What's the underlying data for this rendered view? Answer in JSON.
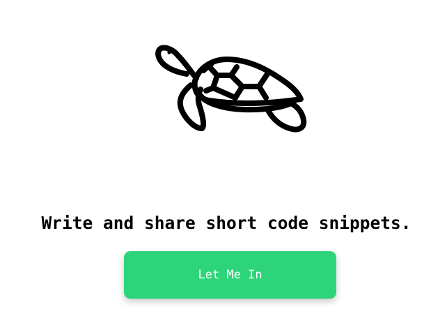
{
  "logo": {
    "icon": "turtle-icon"
  },
  "tagline": "Write and share short code snippets.",
  "cta": {
    "label": "Let Me In"
  },
  "colors": {
    "background": "#ffffff",
    "accent": "#2ed47a",
    "text": "#000000",
    "button_text": "#ffffff"
  }
}
